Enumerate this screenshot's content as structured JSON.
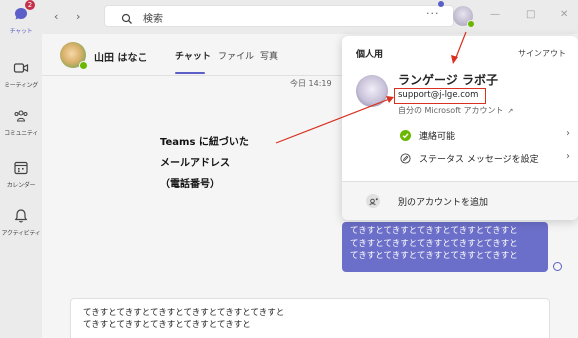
{
  "rail": {
    "items": [
      {
        "label": "チャット",
        "badge": "2"
      },
      {
        "label": "ミーティング"
      },
      {
        "label": "コミュニティ"
      },
      {
        "label": "カレンダー"
      },
      {
        "label": "アクティビティ"
      }
    ]
  },
  "topbar": {
    "search_placeholder": "検索",
    "more": "···"
  },
  "chat": {
    "contact_name": "山田 はなこ",
    "tabs": [
      "チャット",
      "ファイル",
      "写真"
    ],
    "timestamp": "今日 14:19",
    "bubble_lines": [
      "てきすとてきすとてきすとてきすとてきすと",
      "てきすとてきすとてきすとてきすとてきすと",
      "てきすとてきすとてきすとてきすとてきすと"
    ],
    "compose_lines": [
      "てきすとてきすとてきすとてきすとてきすとてきすと",
      "てきすとてきすとてきすとてきすとてきすと"
    ]
  },
  "profile_card": {
    "title": "個人用",
    "signout": "サインアウト",
    "name": "ランゲージ ラボ子",
    "email": "support@j-lge.com",
    "account_type": "自分の Microsoft アカウント",
    "status": "連絡可能",
    "status_message": "ステータス メッセージを設定",
    "add_account": "別のアカウントを追加"
  },
  "annotation": {
    "lines": [
      "Teams に紐づいた",
      "メールアドレス",
      "（電話番号）"
    ]
  },
  "colors": {
    "accent": "#5b5fc7",
    "bubble": "#6c6fc9",
    "available": "#6bb700",
    "badge": "#c4314b",
    "annotation_red": "#d9301f"
  }
}
